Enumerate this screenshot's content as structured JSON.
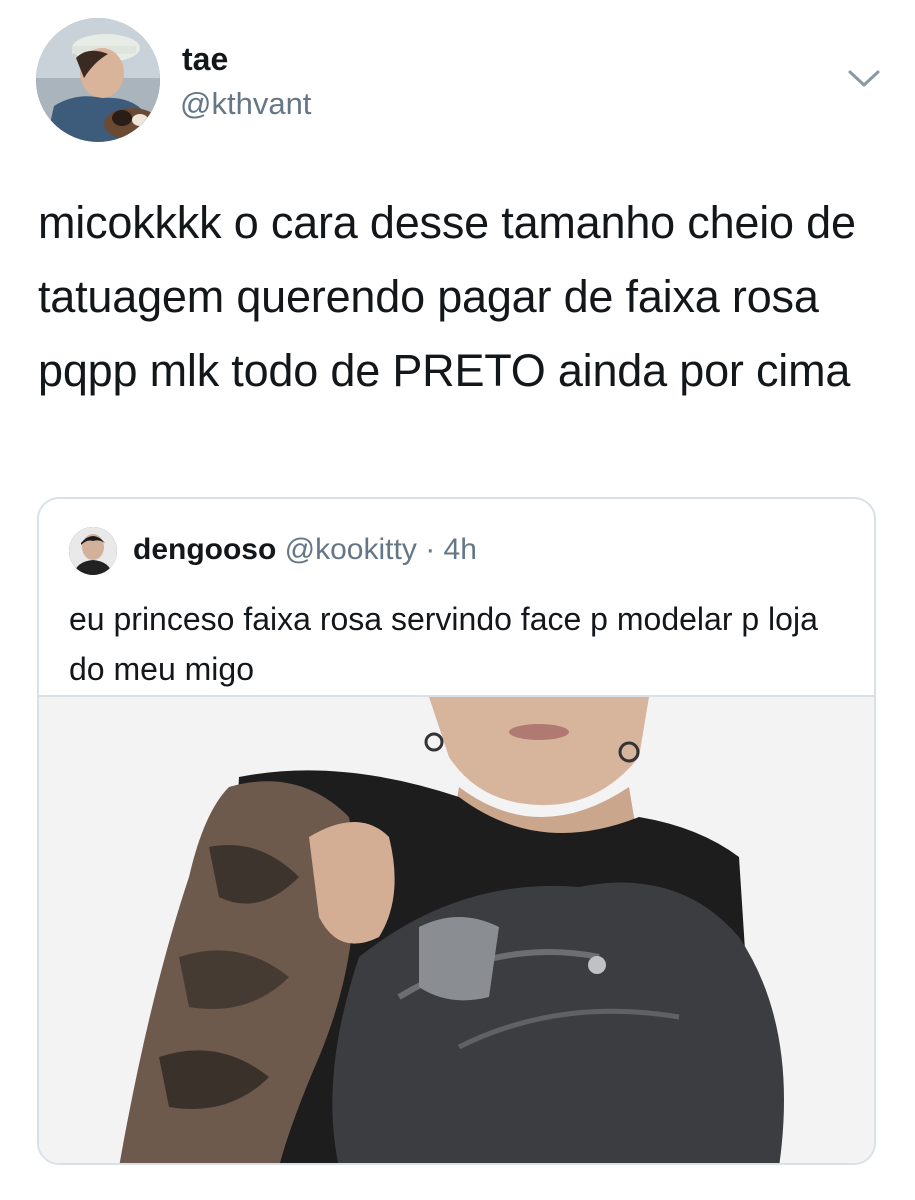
{
  "tweet": {
    "author": {
      "name": "tae",
      "handle": "@kthvant",
      "avatar_icon": "profile-photo"
    },
    "menu_icon": "chevron-down-icon",
    "text": "micokkkk o cara desse tamanho cheio de tatuagem querendo pagar de faixa rosa pqpp mlk todo de PRETO ainda por cima"
  },
  "quoted_tweet": {
    "author": {
      "name": "dengooso",
      "handle": "@kookitty",
      "avatar_icon": "profile-photo"
    },
    "separator": "·",
    "time": "4h",
    "text": "eu princeso faixa rosa servindo face p modelar p loja do meu migo",
    "media_icon": "photo-media"
  },
  "colors": {
    "text_primary": "#14171a",
    "text_secondary": "#657786",
    "border": "#d9e1e8",
    "background": "#ffffff"
  }
}
